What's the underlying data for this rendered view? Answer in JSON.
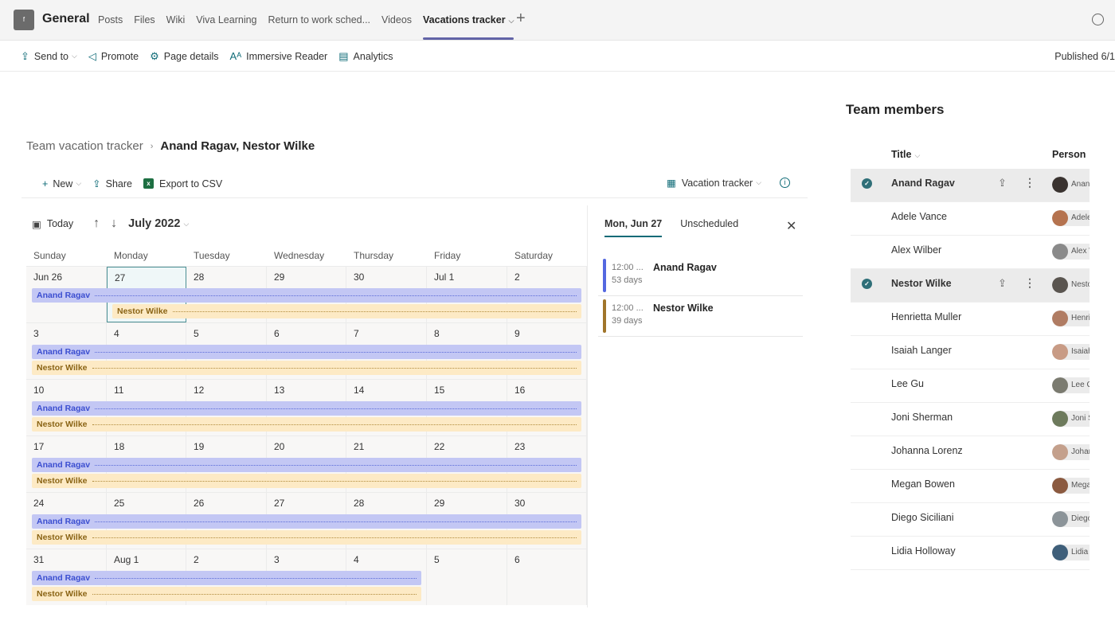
{
  "topbar": {
    "team_initial": "f",
    "channel": "General",
    "tabs": [
      {
        "label": "Posts",
        "active": false
      },
      {
        "label": "Files",
        "active": false
      },
      {
        "label": "Wiki",
        "active": false
      },
      {
        "label": "Viva Learning",
        "active": false
      },
      {
        "label": "Return to work sched...",
        "active": false
      },
      {
        "label": "Videos",
        "active": false
      },
      {
        "label": "Vacations tracker",
        "active": true
      }
    ],
    "add_tab": "+"
  },
  "commandbar": {
    "items": [
      {
        "label": "Send to",
        "icon": "send-icon",
        "glyph": "⇪",
        "dropdown": true
      },
      {
        "label": "Promote",
        "icon": "megaphone-icon",
        "glyph": "◁",
        "dropdown": false
      },
      {
        "label": "Page details",
        "icon": "gear-icon",
        "glyph": "⚙",
        "dropdown": false
      },
      {
        "label": "Immersive Reader",
        "icon": "immersive-reader-icon",
        "glyph": "Aᴬ",
        "dropdown": false
      },
      {
        "label": "Analytics",
        "icon": "analytics-icon",
        "glyph": "▤",
        "dropdown": false
      }
    ],
    "published": "Published 6/1"
  },
  "breadcrumb": {
    "parent": "Team vacation tracker",
    "separator": "›",
    "current": "Anand Ragav, Nestor Wilke"
  },
  "listbar": {
    "new_label": "New",
    "share_label": "Share",
    "export_label": "Export to CSV",
    "view_label": "Vacation tracker",
    "info": "i"
  },
  "calendar": {
    "today_label": "Today",
    "month_label": "July 2022",
    "weekdays": [
      "Sunday",
      "Monday",
      "Tuesday",
      "Wednesday",
      "Thursday",
      "Friday",
      "Saturday"
    ],
    "weeks": [
      [
        "Jun 26",
        "27",
        "28",
        "29",
        "30",
        "Jul 1",
        "2"
      ],
      [
        "3",
        "4",
        "5",
        "6",
        "7",
        "8",
        "9"
      ],
      [
        "10",
        "11",
        "12",
        "13",
        "14",
        "15",
        "16"
      ],
      [
        "17",
        "18",
        "19",
        "20",
        "21",
        "22",
        "23"
      ],
      [
        "24",
        "25",
        "26",
        "27",
        "28",
        "29",
        "30"
      ],
      [
        "31",
        "Aug 1",
        "2",
        "3",
        "4",
        "5",
        "6"
      ]
    ],
    "selected_date": "27",
    "events": [
      {
        "name": "Anand Ragav",
        "start": "2022-06-26",
        "end": "2022-08-04",
        "color": "#c3c7f4"
      },
      {
        "name": "Nestor Wilke",
        "start": "2022-06-27",
        "end": "2022-08-04",
        "color": "#fdeac5"
      }
    ]
  },
  "day_panel": {
    "tabs": [
      {
        "label": "Mon, Jun 27",
        "active": true
      },
      {
        "label": "Unscheduled",
        "active": false
      }
    ],
    "close": "✕",
    "events": [
      {
        "time": "12:00 ...",
        "duration": "53 days",
        "name": "Anand Ragav",
        "color": "#5468e0"
      },
      {
        "time": "12:00 ...",
        "duration": "39 days",
        "name": "Nestor Wilke",
        "color": "#a0752a"
      }
    ]
  },
  "team_members": {
    "title": "Team members",
    "col_title": "Title",
    "col_person": "Person",
    "rows": [
      {
        "name": "Anand Ragav",
        "person": "Anand Ragav",
        "selected": true,
        "avatar_color": "#3a3330"
      },
      {
        "name": "Adele Vance",
        "person": "Adele Vance",
        "selected": false,
        "avatar_color": "#b5734f"
      },
      {
        "name": "Alex Wilber",
        "person": "Alex Wilber",
        "selected": false,
        "avatar_color": "#8a8a8a"
      },
      {
        "name": "Nestor Wilke",
        "person": "Nestor Wilke",
        "selected": true,
        "avatar_color": "#5a5550"
      },
      {
        "name": "Henrietta Muller",
        "person": "Henrietta Mueller",
        "selected": false,
        "avatar_color": "#b07c63"
      },
      {
        "name": "Isaiah Langer",
        "person": "Isaiah Langer",
        "selected": false,
        "avatar_color": "#c89b85"
      },
      {
        "name": "Lee Gu",
        "person": "Lee Gu",
        "selected": false,
        "avatar_color": "#7b7b70"
      },
      {
        "name": "Joni Sherman",
        "person": "Joni Sherman",
        "selected": false,
        "avatar_color": "#6d7a5c"
      },
      {
        "name": "Johanna Lorenz",
        "person": "Johanna Lorenz",
        "selected": false,
        "avatar_color": "#c4a08c"
      },
      {
        "name": "Megan Bowen",
        "person": "Megan Bowen",
        "selected": false,
        "avatar_color": "#8b5a40"
      },
      {
        "name": "Diego Siciliani",
        "person": "Diego Siciliani",
        "selected": false,
        "avatar_color": "#8c9499"
      },
      {
        "name": "Lidia Holloway",
        "person": "Lidia Holloway",
        "selected": false,
        "avatar_color": "#3f5f7a"
      }
    ]
  }
}
